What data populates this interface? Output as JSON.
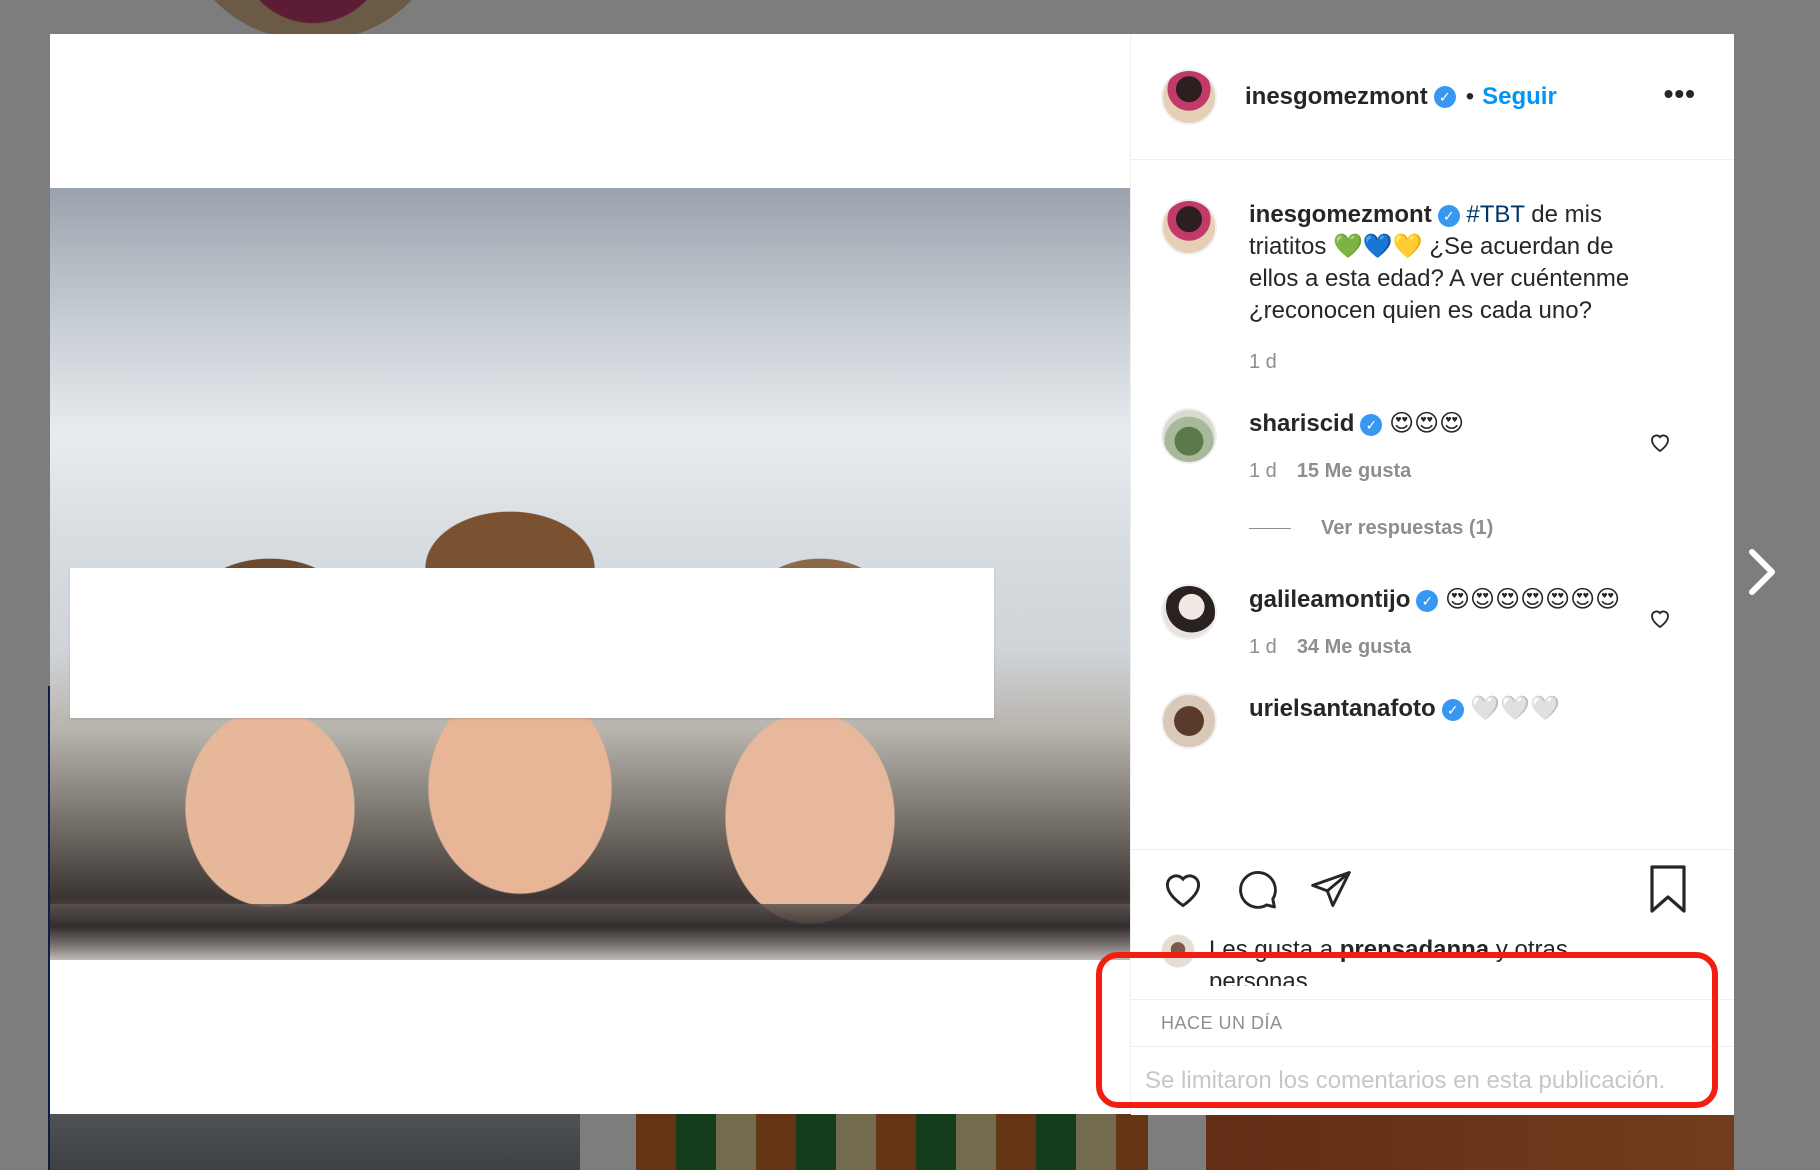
{
  "post": {
    "username": "inesgomezmont",
    "dot": "•",
    "follow_label": "Seguir",
    "more_label": "•••",
    "caption_prefix": "#TBT",
    "caption_rest": " de mis triatitos 💚💙💛 ¿Se acuerdan de ellos a esta edad? A ver cuéntenme ¿reconocen quien es cada uno?",
    "caption_time": "1 d"
  },
  "comments": [
    {
      "username": "shariscid",
      "text": "😍😍😍",
      "time": "1 d",
      "likes": "15 Me gusta",
      "replies": "Ver respuestas (1)"
    },
    {
      "username": "galileamontijo",
      "text": "😍😍😍😍😍😍😍",
      "time": "1 d",
      "likes": "34 Me gusta"
    },
    {
      "username": "urielsantanafoto",
      "text": "🤍🤍🤍"
    }
  ],
  "likes": {
    "prefix": "Les gusta a ",
    "user": "prensadanna",
    "suffix": " y otras personas"
  },
  "timestamp": "HACE UN DÍA",
  "comments_limited": "Se limitaron los comentarios en esta publicación.",
  "colors": {
    "accent": "#0095f6",
    "highlight": "#f21e0f"
  }
}
